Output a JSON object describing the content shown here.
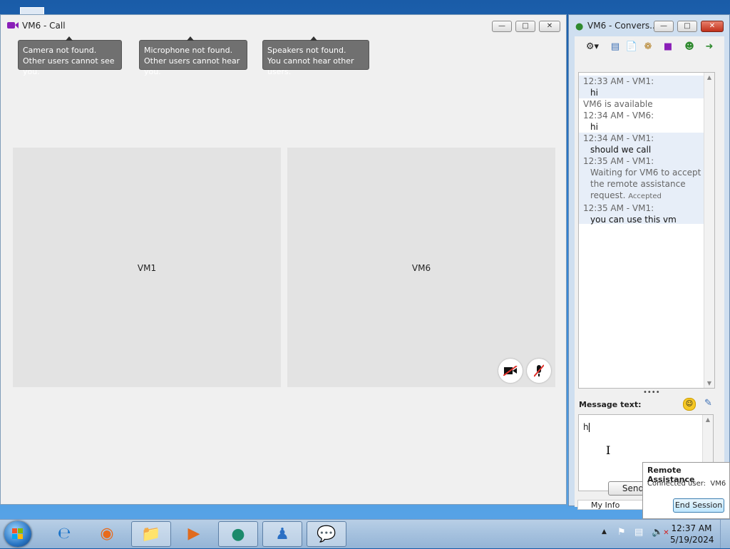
{
  "call_window": {
    "title": "VM6 - Call",
    "tooltips": [
      {
        "line1": "Camera not found.",
        "line2": "Other users cannot see you."
      },
      {
        "line1": "Microphone not found.",
        "line2": "Other users cannot hear you."
      },
      {
        "line1": "Speakers not found.",
        "line2": "You cannot hear other users."
      }
    ],
    "panes": {
      "left": "VM1",
      "right": "VM6"
    }
  },
  "conversation_window": {
    "title": "VM6 - Convers...",
    "messages": [
      {
        "header": "12:33 AM - VM1:",
        "body": "hi"
      },
      {
        "status": "VM6 is available"
      },
      {
        "header": "12:34 AM - VM6:",
        "body": "hi"
      },
      {
        "header": "12:34 AM - VM1:",
        "body": "should we call"
      },
      {
        "header": "12:35 AM - VM1:",
        "body_lines": [
          "Waiting for VM6 to accept",
          "the remote assistance",
          "request."
        ],
        "tag": "Accepted"
      },
      {
        "header": "12:35 AM - VM1:",
        "body": "you can use this vm"
      }
    ],
    "message_label": "Message text:",
    "input_value": "h",
    "send_label": "Send",
    "status_label": "My Info"
  },
  "remote_assistance": {
    "title": "Remote Assistance",
    "connected": "Connected user:  VM6",
    "end_label": "End Session"
  },
  "taskbar": {
    "time": "12:37 AM",
    "date": "5/19/2024"
  }
}
